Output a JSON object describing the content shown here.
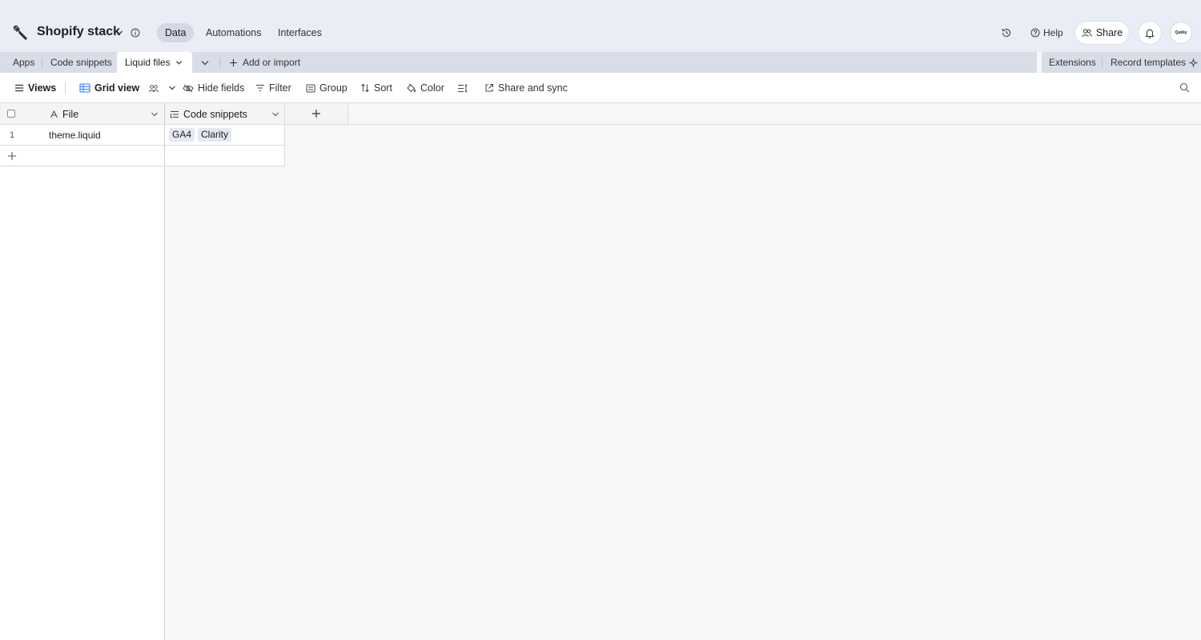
{
  "header": {
    "base_title": "Shopify stack",
    "nav": [
      {
        "label": "Data",
        "active": true
      },
      {
        "label": "Automations",
        "active": false
      },
      {
        "label": "Interfaces",
        "active": false
      }
    ],
    "help_label": "Help",
    "share_label": "Share",
    "avatar_text": "Quirky"
  },
  "tabs": {
    "items": [
      "Apps",
      "Code snippets",
      "Liquid files"
    ],
    "active": "Liquid files",
    "add_import_label": "Add or import",
    "extensions_label": "Extensions",
    "record_templates_label": "Record templates"
  },
  "toolbar": {
    "views_label": "Views",
    "grid_view_label": "Grid view",
    "hide_fields_label": "Hide fields",
    "filter_label": "Filter",
    "group_label": "Group",
    "sort_label": "Sort",
    "color_label": "Color",
    "share_sync_label": "Share and sync"
  },
  "grid": {
    "columns": [
      "File",
      "Code snippets"
    ],
    "rows": [
      {
        "num": "1",
        "file": "theme.liquid",
        "snippets": [
          "GA4",
          "Clarity"
        ]
      }
    ]
  },
  "colors": {
    "header_bg": "#e9edf5",
    "tabs_bg": "#d8dde7",
    "grid_bg": "#f7f7f7",
    "chip_bg": "#e4e8f0",
    "accent_blue": "#2d7ff9"
  },
  "icons": [
    "tool-icon",
    "chevron-down-icon",
    "info-icon",
    "history-icon",
    "help-icon",
    "people-icon",
    "bell-icon",
    "plus-icon",
    "sparkle-icon",
    "menu-icon",
    "grid-icon",
    "eye-off-icon",
    "filter-icon",
    "group-icon",
    "sort-icon",
    "paint-icon",
    "row-height-icon",
    "share-sync-icon",
    "search-icon",
    "text-field-icon",
    "link-field-icon"
  ]
}
